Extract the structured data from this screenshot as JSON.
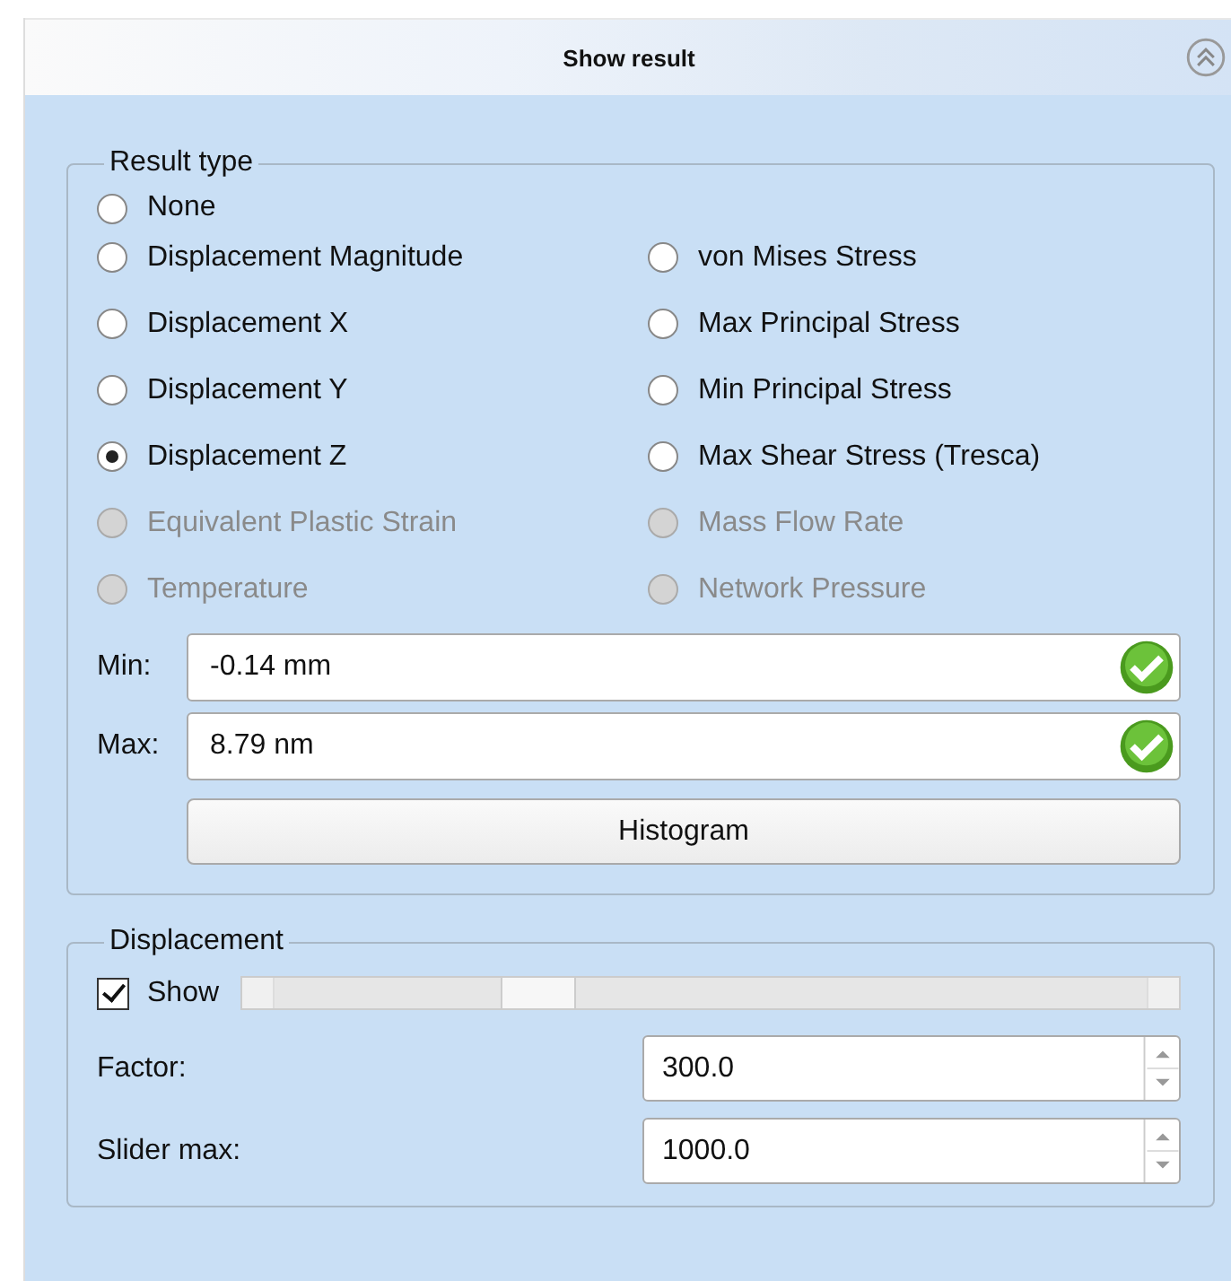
{
  "panel": {
    "title": "Show result"
  },
  "result_type": {
    "title": "Result type",
    "none": {
      "label": "None",
      "selected": false,
      "disabled": false
    },
    "left": [
      {
        "label": "Displacement Magnitude",
        "selected": false,
        "disabled": false
      },
      {
        "label": "Displacement X",
        "selected": false,
        "disabled": false
      },
      {
        "label": "Displacement Y",
        "selected": false,
        "disabled": false
      },
      {
        "label": "Displacement Z",
        "selected": true,
        "disabled": false
      },
      {
        "label": "Equivalent Plastic Strain",
        "selected": false,
        "disabled": true
      },
      {
        "label": "Temperature",
        "selected": false,
        "disabled": true
      }
    ],
    "right": [
      {
        "label": "von Mises Stress",
        "selected": false,
        "disabled": false
      },
      {
        "label": "Max Principal Stress",
        "selected": false,
        "disabled": false
      },
      {
        "label": "Min Principal Stress",
        "selected": false,
        "disabled": false
      },
      {
        "label": "Max Shear Stress (Tresca)",
        "selected": false,
        "disabled": false
      },
      {
        "label": "Mass Flow Rate",
        "selected": false,
        "disabled": true
      },
      {
        "label": "Network Pressure",
        "selected": false,
        "disabled": true
      }
    ],
    "fields": [
      {
        "label": "Min:",
        "value": "-0.14 mm"
      },
      {
        "label": "Max:",
        "value": "8.79 nm"
      }
    ],
    "button": "Histogram"
  },
  "displacement": {
    "title": "Displacement",
    "show": {
      "label": "Show",
      "checked": true
    },
    "slider": {
      "level": 0.3
    },
    "spins": [
      {
        "label": "Factor:",
        "value": "300.0"
      },
      {
        "label": "Slider max:",
        "value": "1000.0"
      }
    ]
  }
}
